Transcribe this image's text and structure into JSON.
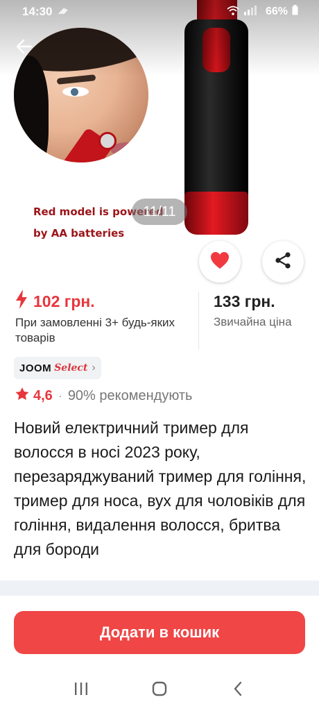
{
  "status_bar": {
    "time": "14:30",
    "battery": "66%",
    "icons": [
      "notification-icon",
      "wifi-icon",
      "signal-icon",
      "battery-icon"
    ]
  },
  "gallery": {
    "caption_line1": "Red model is powered",
    "caption_line2": "by AA batteries",
    "counter": "11/11"
  },
  "price": {
    "promo_price": "102 грн.",
    "promo_note": "При замовленні 3+ будь-яких товарів",
    "regular_price": "133 грн.",
    "regular_note": "Звичайна ціна"
  },
  "badge": {
    "joom": "JOOM",
    "select": "Select",
    "chevron": "›"
  },
  "rating": {
    "value": "4,6",
    "separator": "·",
    "recommend": "90% рекомендують"
  },
  "product": {
    "title": "Новий електричний тример для волосся в носі 2023 року, перезаряджуваний тример для гоління, тример для носа, вух для чоловіків для гоління, видалення волосся, бритва для бороди"
  },
  "cta": {
    "label": "Додати в кошик"
  },
  "colors": {
    "accent": "#f04646",
    "promo": "#e8363d",
    "caption": "#9b1419"
  }
}
